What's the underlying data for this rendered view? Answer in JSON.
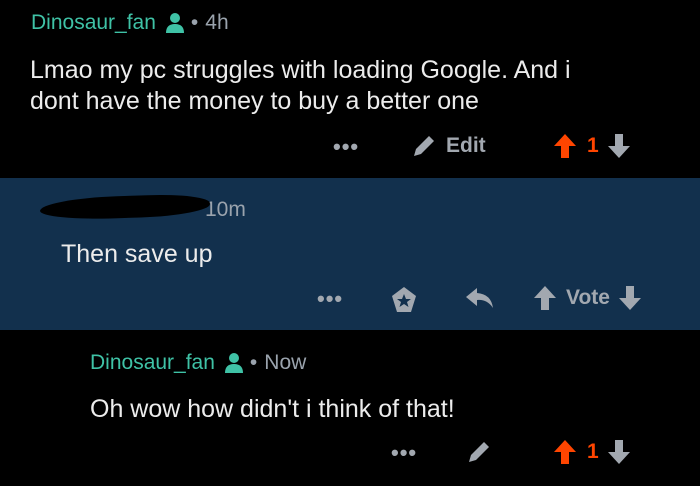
{
  "comment1": {
    "username": "Dinosaur_fan",
    "dot": "•",
    "time": "4h",
    "text_line1": "Lmao my pc struggles with loading Google. And i",
    "text_line2": "dont have the money to buy a better one",
    "more": "•••",
    "edit_label": "Edit",
    "vote_count": "1"
  },
  "comment2": {
    "time_partial": "10m",
    "text": "Then save up",
    "more": "•••",
    "vote_label": "Vote"
  },
  "comment3": {
    "username": "Dinosaur_fan",
    "dot": "•",
    "time": "Now",
    "text": "Oh wow how didn't i think of that!",
    "more": "•••",
    "vote_count": "1"
  },
  "colors": {
    "username": "#3fc2a6",
    "upvote": "#ff4500",
    "highlight_bg": "#12304d"
  },
  "icons": [
    "user-icon",
    "pencil-icon",
    "award-icon",
    "share-icon",
    "upvote-icon",
    "downvote-icon"
  ]
}
